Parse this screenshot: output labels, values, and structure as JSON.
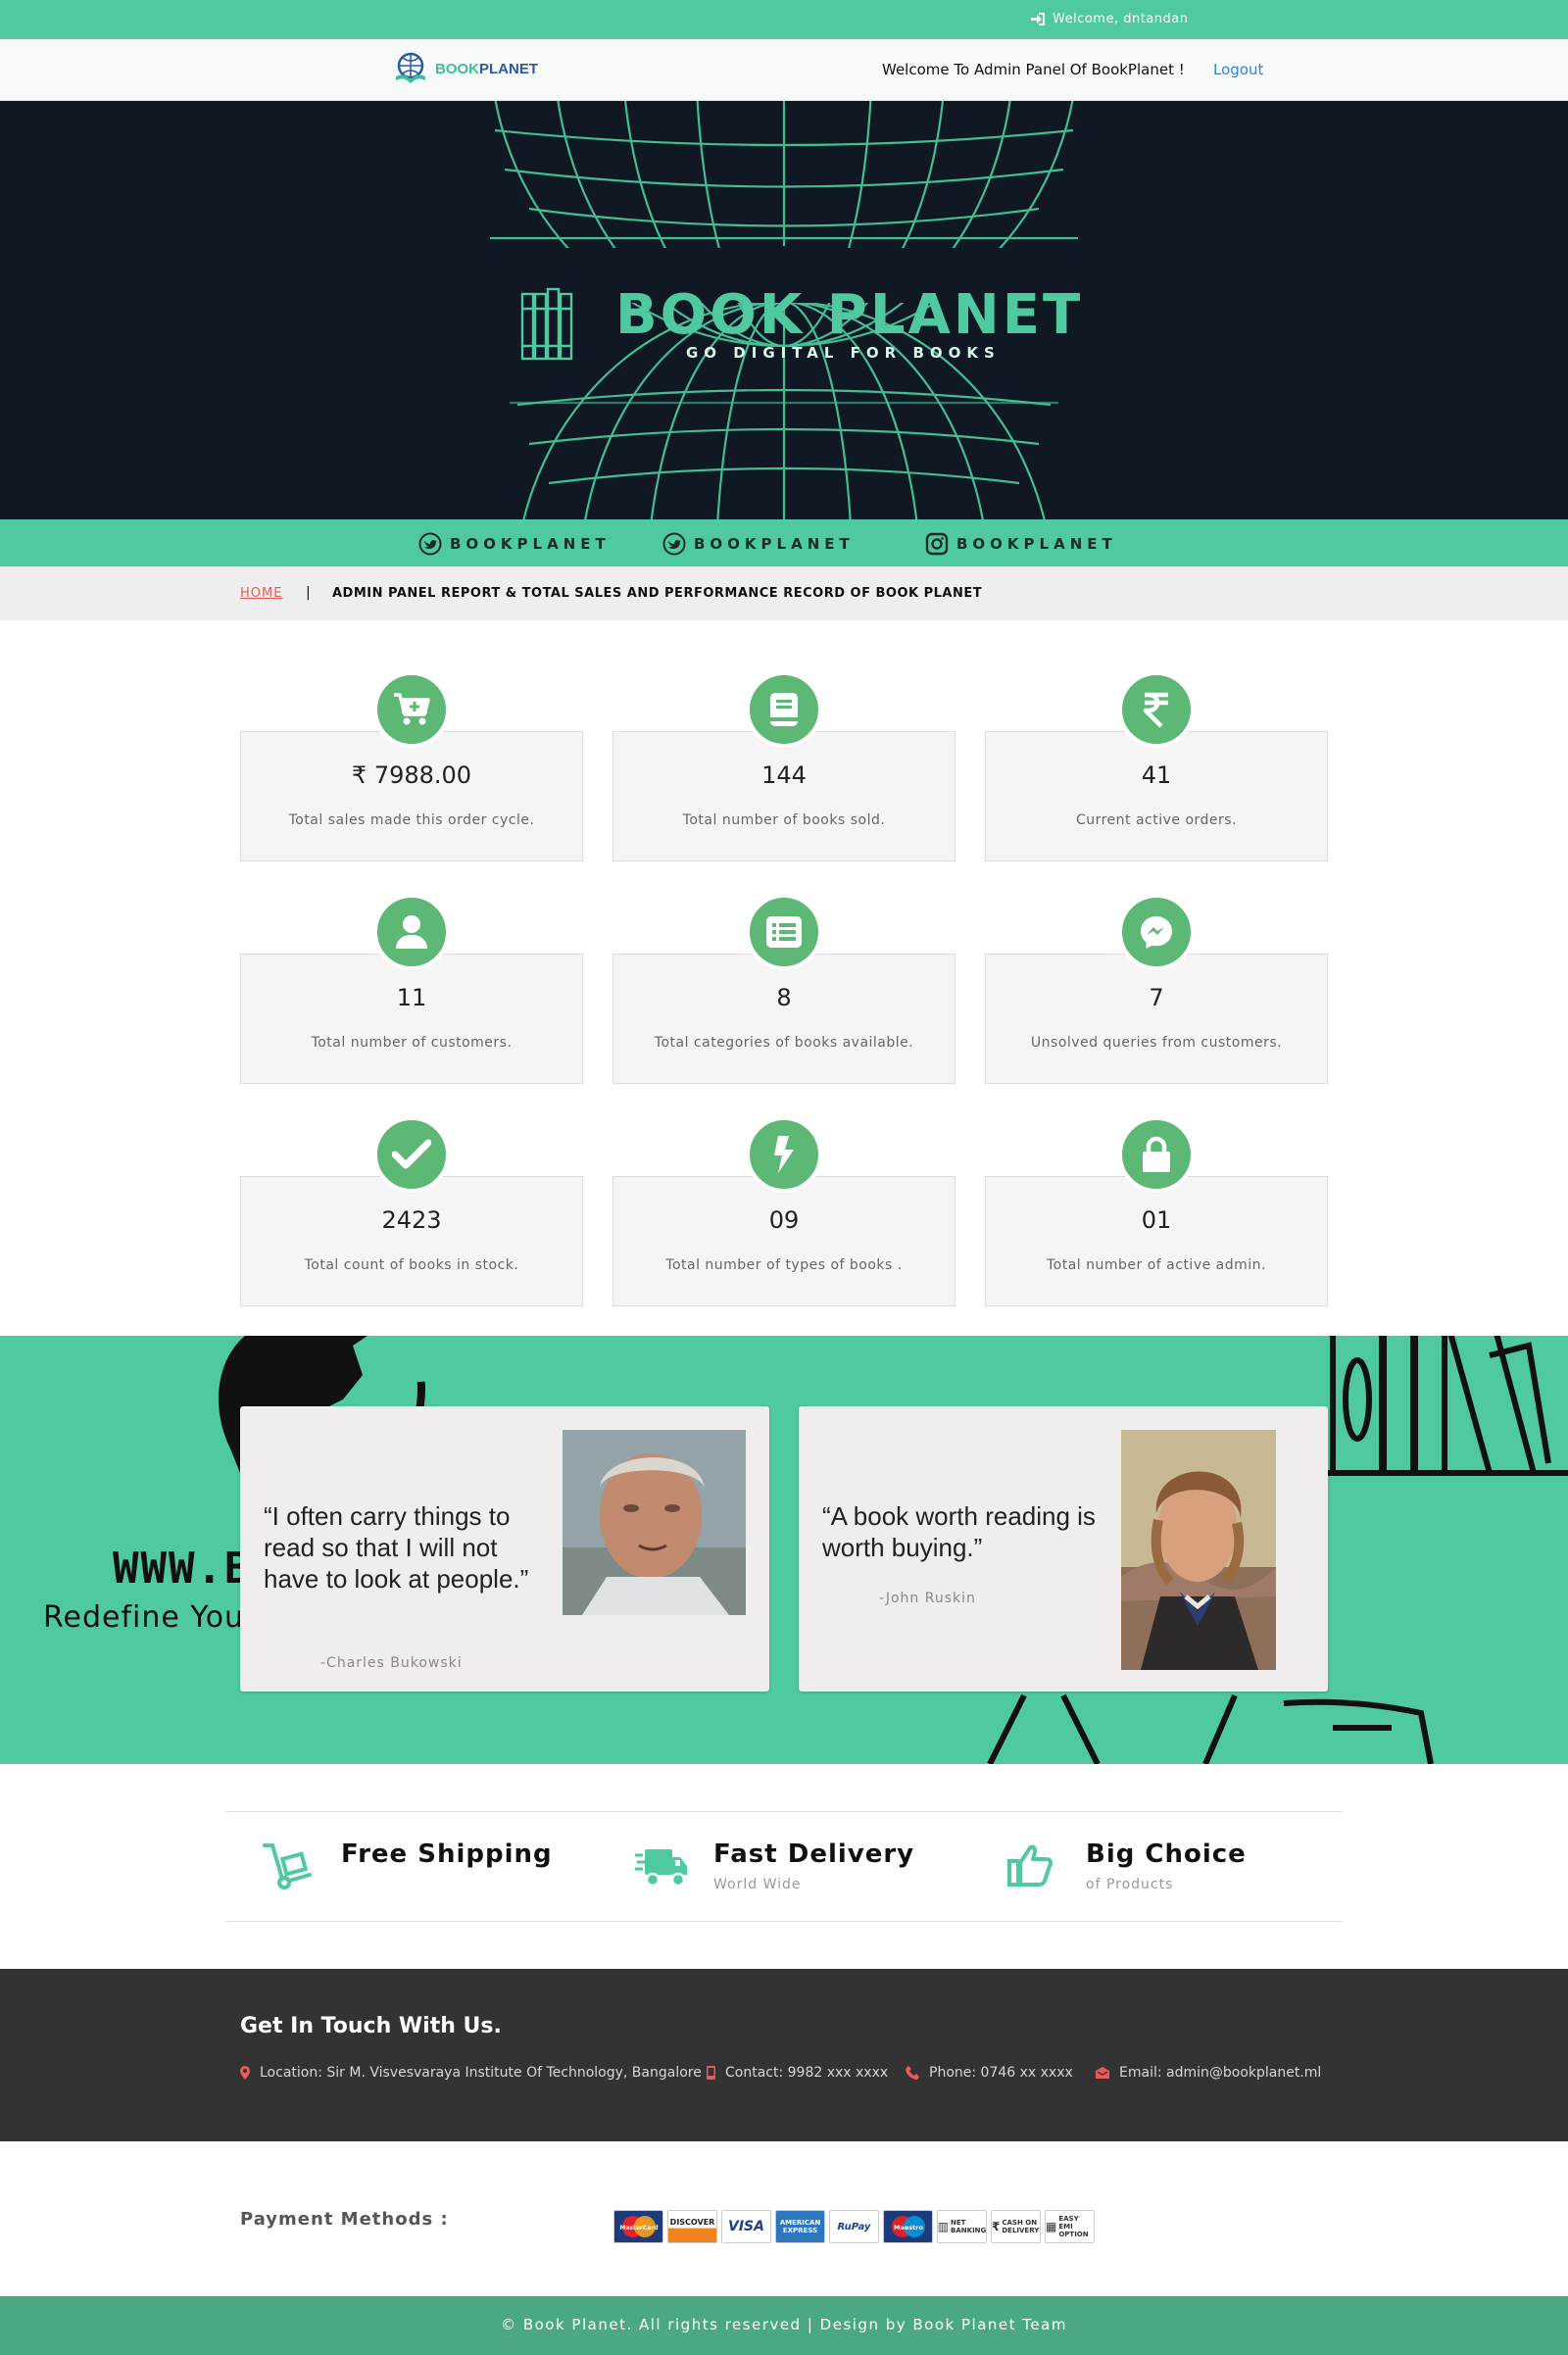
{
  "topbar": {
    "welcome": "Welcome, dntandan",
    "icon": "sign-in-icon"
  },
  "header": {
    "logo_part1": "BOOK",
    "logo_part2": "PLANET",
    "admin_title": "Welcome To Admin Panel Of BookPlanet !",
    "logout_label": "Logout"
  },
  "hero": {
    "brand": "BOOK PLANET",
    "tagline": "GO DIGITAL FOR BOOKS"
  },
  "social": {
    "items": [
      {
        "icon": "twitter-icon",
        "label": "BOOKPLANET"
      },
      {
        "icon": "facebook-icon",
        "label": "BOOKPLANET"
      },
      {
        "icon": "instagram-icon",
        "label": "BOOKPLANET"
      }
    ]
  },
  "breadcrumb": {
    "home": "HOME",
    "separator": "|",
    "title": "ADMIN PANEL REPORT & TOTAL SALES AND PERFORMANCE RECORD OF BOOK PLANET"
  },
  "stats": [
    {
      "icon": "cart-plus-icon",
      "value": "₹ 7988.00",
      "desc": "Total sales made this order cycle."
    },
    {
      "icon": "book-icon",
      "value": "144",
      "desc": "Total number of books sold."
    },
    {
      "icon": "rupee-icon",
      "value": "41",
      "desc": "Current active orders."
    },
    {
      "icon": "user-icon",
      "value": "11",
      "desc": "Total number of customers."
    },
    {
      "icon": "list-icon",
      "value": "8",
      "desc": "Total categories of books available."
    },
    {
      "icon": "messenger-icon",
      "value": "7",
      "desc": "Unsolved queries from customers."
    },
    {
      "icon": "check-icon",
      "value": "2423",
      "desc": "Total count of books in stock."
    },
    {
      "icon": "bolt-icon",
      "value": "09",
      "desc": "Total number of types of books ."
    },
    {
      "icon": "lock-icon",
      "value": "01",
      "desc": "Total number of active admin."
    }
  ],
  "quotes_bg": {
    "text1": "WWW.B",
    "text2": "Redefine You"
  },
  "quotes": [
    {
      "text": "“I often carry things to read so that I will not have to look at people.”",
      "author": "-Charles Bukowski"
    },
    {
      "text": "“A book worth reading is worth buying.”",
      "author": "-John Ruskin"
    }
  ],
  "features": [
    {
      "icon": "dolly-icon",
      "title": "Free Shipping",
      "subtitle": ""
    },
    {
      "icon": "truck-icon",
      "title": "Fast Delivery",
      "subtitle": "World Wide"
    },
    {
      "icon": "thumbs-up-icon",
      "title": "Big Choice",
      "subtitle": "of Products"
    }
  ],
  "contact": {
    "heading": "Get In Touch With Us.",
    "items": [
      {
        "icon": "map-marker-icon",
        "text": "Location: Sir M. Visvesvaraya Institute Of Technology, Bangalore"
      },
      {
        "icon": "mobile-icon",
        "text": "Contact: 9982 xxx xxxx"
      },
      {
        "icon": "phone-icon",
        "text": "Phone: 0746 xx xxxx"
      },
      {
        "icon": "envelope-icon",
        "text": "Email: admin@bookplanet.ml"
      }
    ]
  },
  "payment": {
    "label": "Payment Methods :",
    "methods": [
      "MasterCard",
      "DISCOVER",
      "VISA",
      "AMERICAN EXPRESS",
      "RuPay",
      "Maestro",
      "NET BANKING",
      "CASH ON DELIVERY",
      "EASY EMI OPTION"
    ]
  },
  "footer": {
    "copyright": "© Book Planet. All rights reserved | Design by Book Planet Team"
  },
  "colors": {
    "accent": "#4fc99f",
    "icon_green": "#5cb874",
    "dark": "#101923",
    "footer": "#4aa882",
    "contact_bg": "#333333",
    "home_red": "#e8594f",
    "link": "#2c87d4"
  }
}
